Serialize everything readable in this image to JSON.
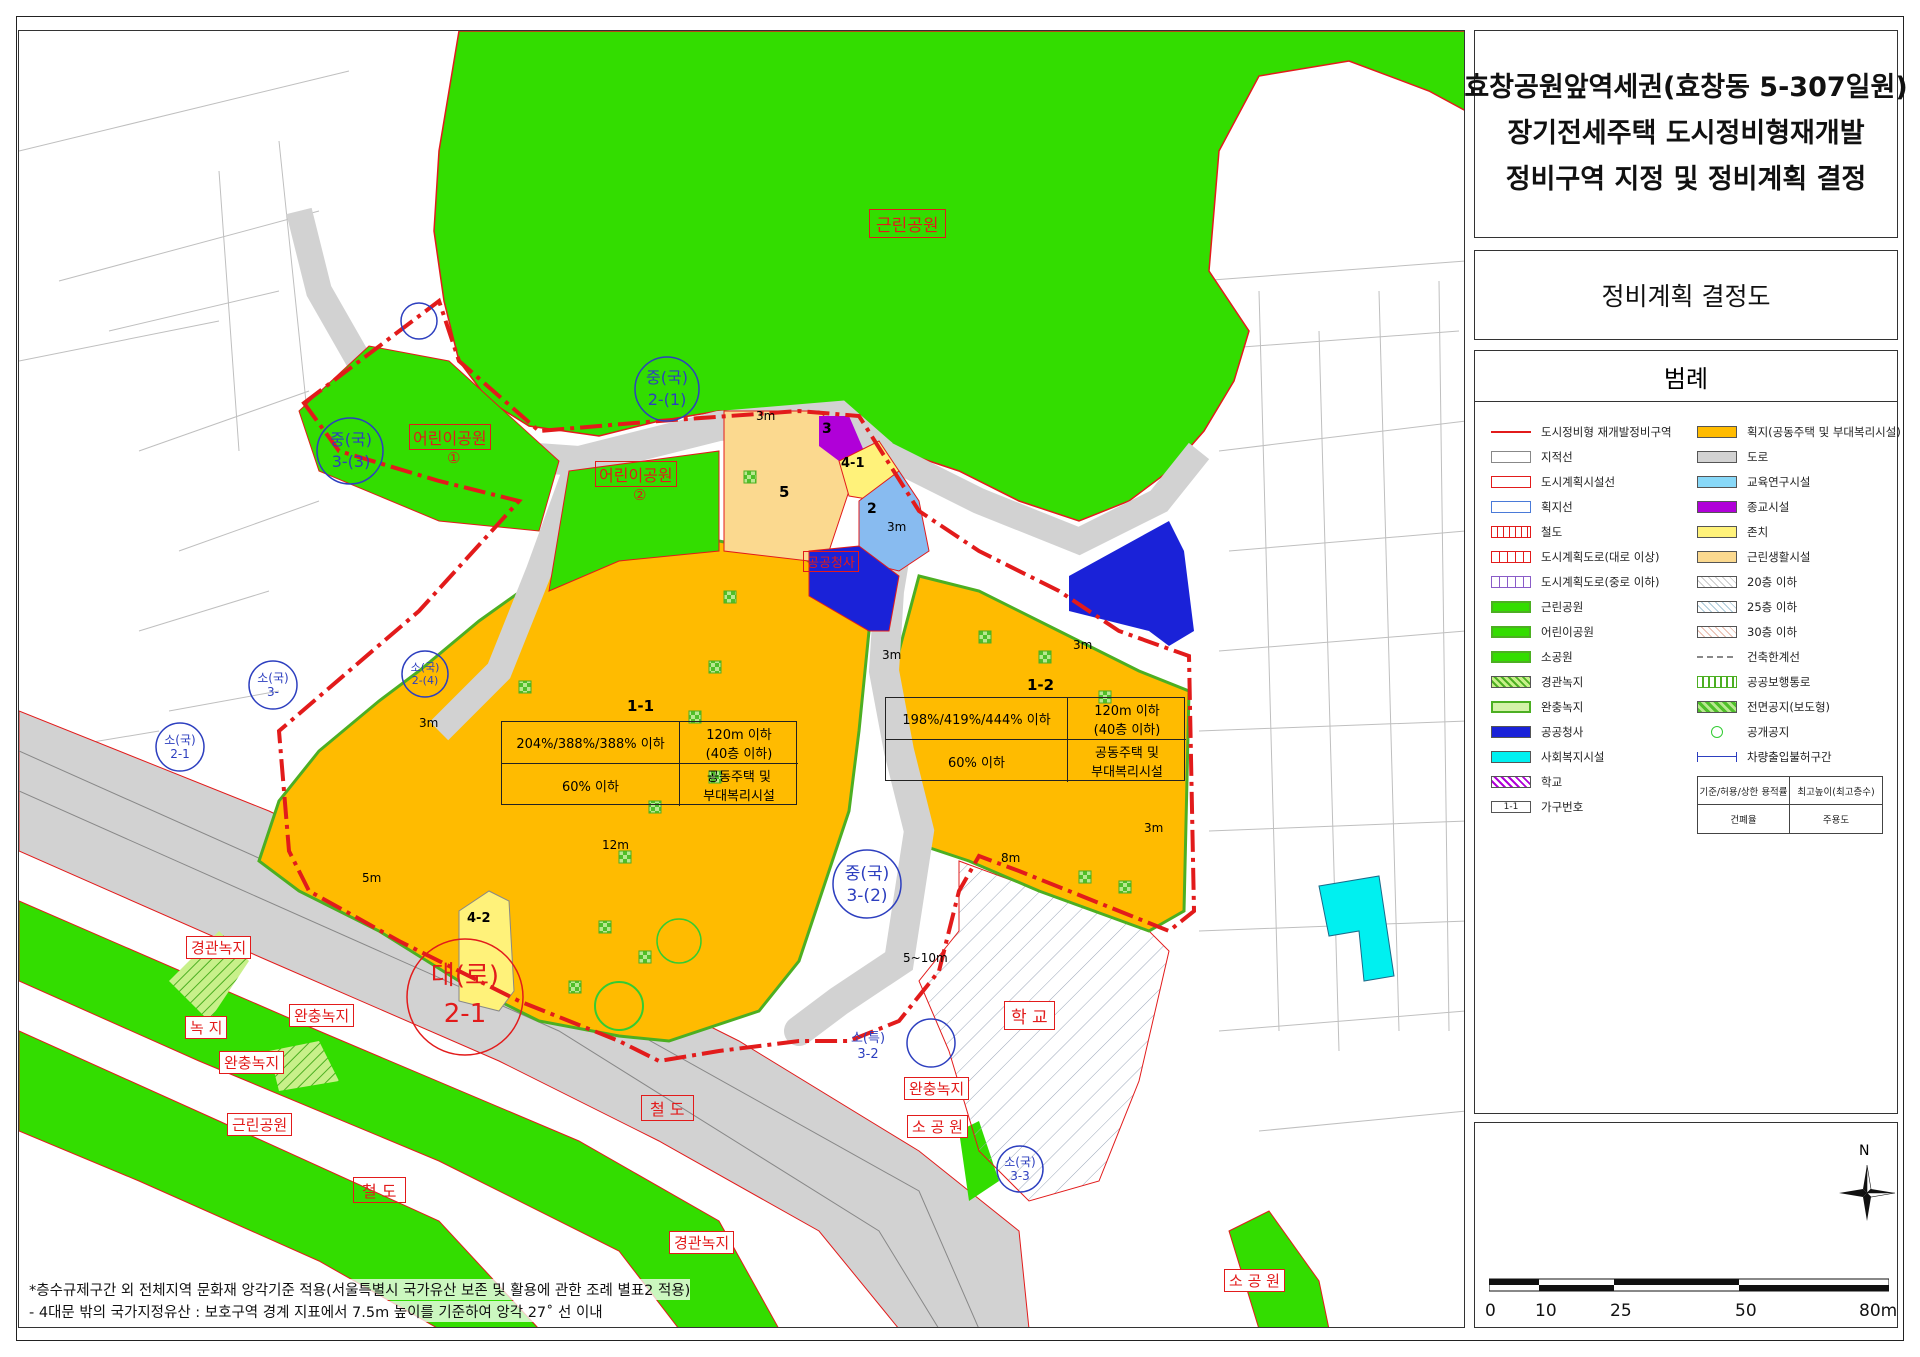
{
  "title_lines": [
    "효창공원앞역세권(효창동 5-307일원)",
    "장기전세주택 도시정비형재개발",
    "정비구역 지정 및 정비계획 결정"
  ],
  "subtitle": "정비계획 결정도",
  "legend": {
    "heading": "범례",
    "left": [
      {
        "label": "도시정비형 재개발정비구역",
        "icon": "dashdot-red"
      },
      {
        "label": "지적선",
        "icon": "line-gray"
      },
      {
        "label": "도시계획시설선",
        "icon": "line-red"
      },
      {
        "label": "획지선",
        "icon": "line-blue"
      },
      {
        "label": "철도",
        "icon": "rail"
      },
      {
        "label": "도시계획도로(대로 이상)",
        "icon": "road-large"
      },
      {
        "label": "도시계획도로(중로 이하)",
        "icon": "road-medium"
      },
      {
        "label": "근린공원",
        "icon": "green"
      },
      {
        "label": "어린이공원",
        "icon": "green"
      },
      {
        "label": "소공원",
        "icon": "green"
      },
      {
        "label": "경관녹지",
        "icon": "green-hatch"
      },
      {
        "label": "완충녹지",
        "icon": "green-light"
      },
      {
        "label": "공공청사",
        "icon": "blue"
      },
      {
        "label": "사회복지시설",
        "icon": "cyan"
      },
      {
        "label": "학교",
        "icon": "school-hatch"
      },
      {
        "label": "가구번호",
        "icon": "block-number"
      }
    ],
    "right": [
      {
        "label": "획지(공동주택 및 부대복리시설)",
        "icon": "orange"
      },
      {
        "label": "도로",
        "icon": "gray"
      },
      {
        "label": "교육연구시설",
        "icon": "sky"
      },
      {
        "label": "종교시설",
        "icon": "purple"
      },
      {
        "label": "존치",
        "icon": "yellow"
      },
      {
        "label": "근린생활시설",
        "icon": "tan"
      },
      {
        "label": "20층 이하",
        "icon": "hatch-20"
      },
      {
        "label": "25층 이하",
        "icon": "hatch-25"
      },
      {
        "label": "30층 이하",
        "icon": "hatch-30"
      },
      {
        "label": "건축한계선",
        "icon": "dash-gray"
      },
      {
        "label": "공공보행통로",
        "icon": "walkway"
      },
      {
        "label": "전면공지(보도형)",
        "icon": "green-check"
      },
      {
        "label": "공개공지",
        "icon": "circle-green"
      },
      {
        "label": "차량출입불허구간",
        "icon": "no-vehicle"
      }
    ],
    "ratio_key": {
      "far": "기준/허용/상한 용적률",
      "height": "최고높이(최고층수)",
      "bcr": "건폐율",
      "use": "주용도"
    }
  },
  "north_label": "N",
  "scale": {
    "labels": [
      "0",
      "10",
      "25",
      "50",
      "80m"
    ]
  },
  "blocks": [
    {
      "id": "1-1",
      "far": "204%/388%/388% 이하",
      "height": "120m 이하",
      "floors": "(40층 이하)",
      "bcr": "60% 이하",
      "use1": "공동주택 및",
      "use2": "부대복리시설"
    },
    {
      "id": "1-2",
      "far": "198%/419%/444% 이하",
      "height": "120m 이하",
      "floors": "(40층 이하)",
      "bcr": "60% 이하",
      "use1": "공동주택 및",
      "use2": "부대복리시설"
    }
  ],
  "map_labels": {
    "park": "근린공원",
    "kids_park": "어린이공원",
    "kids_park_1": "①",
    "kids_park_2": "②",
    "lot_2": "2",
    "lot_3": "3",
    "lot_4_1": "4-1",
    "lot_4_2": "4-2",
    "lot_5": "5",
    "office": "공공청사",
    "school": "학  교",
    "rail1": "철    도",
    "rail2": "철    도",
    "buffer1": "완충녹지",
    "buffer2": "완충녹지",
    "buffer3": "완충녹지",
    "scenic1": "경관녹지",
    "scenic2": "경관녹지",
    "green": "녹    지",
    "nbhd_park": "근린공원",
    "small_park1": "소 공 원",
    "small_park2": "소 공 원",
    "d3m_1": "3m",
    "d3m_2": "3m",
    "d3m_3": "3m",
    "d3m_4": "3m",
    "d3m_5": "3m",
    "d3m_6": "3m",
    "d5m": "5m",
    "d8m": "8m",
    "d12m": "12m",
    "d5_10m": "5~10m",
    "road_a_top": "중(국)",
    "road_a_bot": "2-(1)",
    "road_b_top": "중(국)",
    "road_b_bot": "3-(3)",
    "road_c_top": "소(국)",
    "road_c_bot": "2-(4)",
    "road_d_top": "소(국)",
    "road_d_bot": "3-",
    "road_e_top": "소(국)",
    "road_e_bot": "2-1",
    "road_f_top": "중(국)",
    "road_f_bot": "3-(2)",
    "road_g_top": "대(로)",
    "road_g_bot": "2-1",
    "road_h_top": "소(특)",
    "road_h_bot": "3-2",
    "road_i_top": "소(국)",
    "road_i_bot": "3-3"
  },
  "notes": [
    "*층수규제구간 외 전체지역 문화재 앙각기준 적용(서울특별시 국가유산 보존 및 활용에 관한 조례 별표2 적용)",
    "  - 4대문 밖의 국가지정유산 : 보호구역 경계 지표에서 7.5m 높이를 기준하여 앙각 27˚ 선 이내"
  ],
  "colors": {
    "park": "#33dd00",
    "orange": "#ffbb00",
    "road": "#d2d2d2",
    "boundary": "#e21b1b",
    "office": "#1a22d8",
    "edu": "#88bbf0",
    "religion": "#b000d8",
    "keep": "#fff27a",
    "retail": "#fbd98f",
    "social": "#00f0f0"
  }
}
